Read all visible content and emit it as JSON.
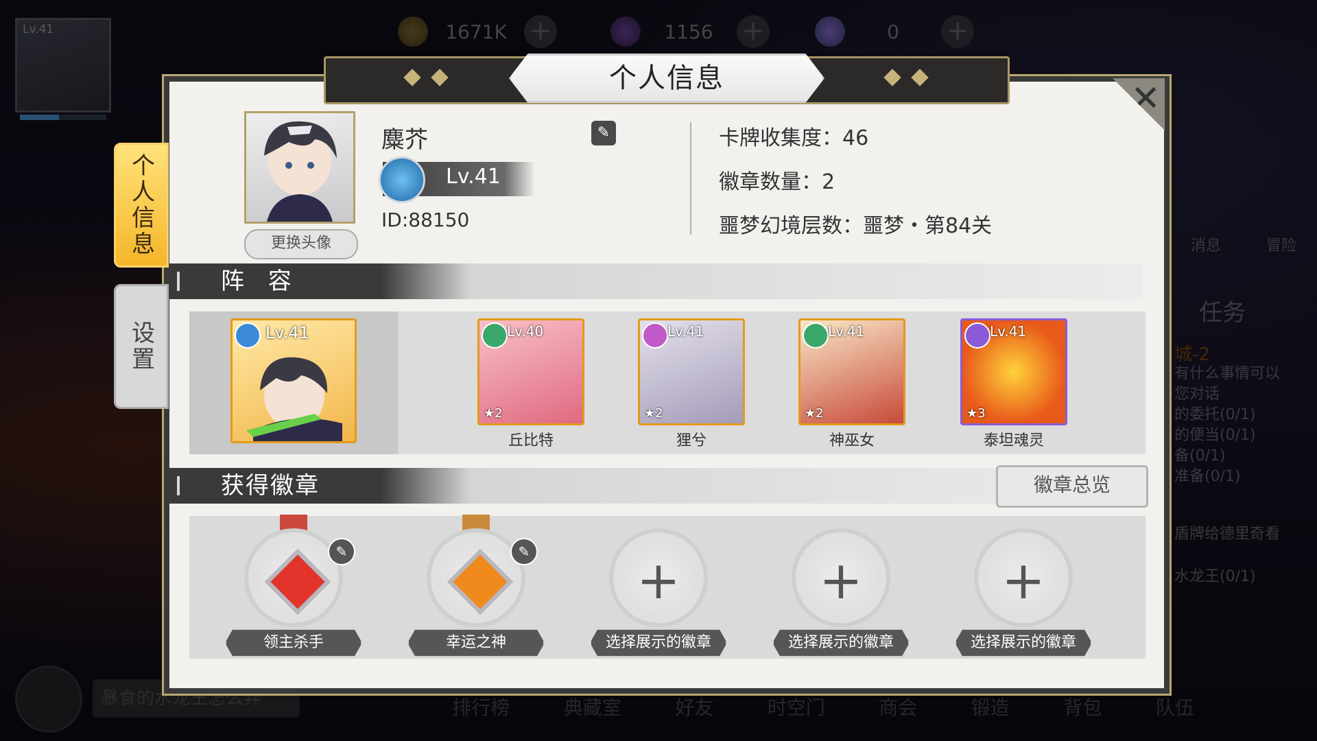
{
  "hud": {
    "avatar_level": "Lv.41",
    "gold": "1671K",
    "crystal": "1156",
    "tokens": "0",
    "messages_label": "消息",
    "adventure_label": "冒险",
    "task_button": "任务",
    "quest_title": "城-2",
    "quest_lines": [
      "有什么事情可以",
      "您对话",
      "的委托(0/1)",
      "的便当(0/1)",
      "备(0/1)",
      "准备(0/1)"
    ],
    "quest_extra1": "盾牌给德里奇看",
    "quest_extra2": "水龙王(0/1)",
    "chat_text": "暴食的水龙王怎么弃"
  },
  "bottom_nav": [
    "排行榜",
    "典藏室",
    "好友",
    "时空门",
    "商会",
    "锻造",
    "背包",
    "队伍"
  ],
  "panel": {
    "title": "个人信息",
    "close": "✕",
    "tabs": {
      "info": "个人信息",
      "settings": "设置"
    }
  },
  "profile": {
    "name": "麋芥",
    "level": "Lv.41",
    "id": "ID:88150",
    "change_avatar": "更换头像",
    "stats": {
      "cards": "卡牌收集度：46",
      "badges": "徽章数量：2",
      "nightmare": "噩梦幻境层数：噩梦・第84关"
    }
  },
  "lineup": {
    "header": "阵 容",
    "leader": {
      "level": "Lv.41"
    },
    "members": [
      {
        "name": "丘比特",
        "level": "Lv.40",
        "stars": "★2"
      },
      {
        "name": "狸兮",
        "level": "Lv.41",
        "stars": "★2"
      },
      {
        "name": "神巫女",
        "level": "Lv.41",
        "stars": "★2"
      },
      {
        "name": "泰坦魂灵",
        "level": "Lv.41",
        "stars": "★3"
      }
    ]
  },
  "badges": {
    "header": "获得徽章",
    "overview_button": "徽章总览",
    "slots": [
      {
        "label": "领主杀手",
        "filled": true,
        "gem_color": "#e2342a",
        "ribbon_color": "#c94a3c"
      },
      {
        "label": "幸运之神",
        "filled": true,
        "gem_color": "#f08a1c",
        "ribbon_color": "#c98a3c"
      },
      {
        "label": "选择展示的徽章",
        "filled": false
      },
      {
        "label": "选择展示的徽章",
        "filled": false
      },
      {
        "label": "选择展示的徽章",
        "filled": false
      }
    ]
  }
}
